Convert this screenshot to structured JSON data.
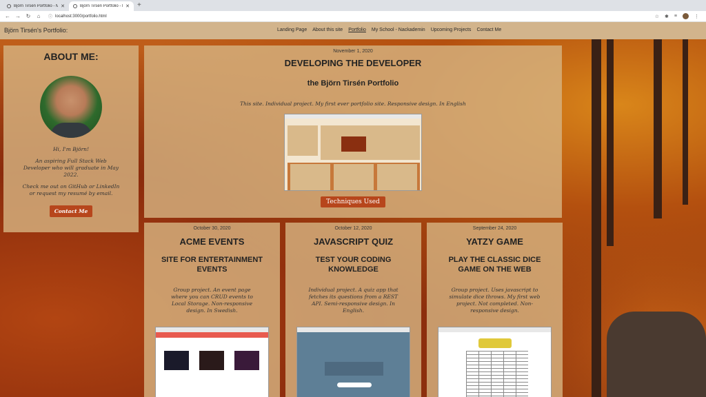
{
  "browser": {
    "tabs": [
      {
        "title": "Björn Tirsén Portfolio - My Sch"
      },
      {
        "title": "Björn Tirsén Portfolio - Develo"
      }
    ],
    "url": "localhost:3000/portfolio.html"
  },
  "site": {
    "brand": "Björn Tirsén's Portfolio:",
    "nav": [
      "Landing Page",
      "About this site",
      "Portfolio",
      "My School - Nackademin",
      "Upcoming Projects",
      "Contact Me"
    ]
  },
  "about": {
    "title": "ABOUT ME:",
    "greeting": "Hi, I'm Björn!",
    "bio": "An aspiring Full Stack Web Developer who will graduate in May 2022.",
    "cta_text": "Check me out on GitHub or LinkedIn or request my resumé by email.",
    "button": "Contact Me"
  },
  "feature": {
    "date": "November 1, 2020",
    "title": "DEVELOPING THE DEVELOPER",
    "subtitle": "the Björn Tirsén Portfolio",
    "desc": "This site. Individual project. My first ever portfolio site. Responsive design. In English",
    "button": "Techniques Used"
  },
  "cards": [
    {
      "date": "October 30, 2020",
      "title": "ACME EVENTS",
      "subtitle": "SITE FOR ENTERTAINMENT EVENTS",
      "desc": "Group project. An event page where you can CRUD events to Local Storage. Non-responsive design. In Swedish."
    },
    {
      "date": "October 12, 2020",
      "title": "JAVASCRIPT QUIZ",
      "subtitle": "TEST YOUR CODING KNOWLEDGE",
      "desc": "Individual project. A quiz app that fetches its questions from a REST API. Semi-responsive design. In English."
    },
    {
      "date": "September 24, 2020",
      "title": "YATZY GAME",
      "subtitle": "PLAY THE CLASSIC DICE GAME ON THE WEB",
      "desc": "Group project. Uses javascript to simulate dice throws. My first web project. Not completed. Non-responsive design."
    }
  ],
  "colors": {
    "accent_button": "#b7461c",
    "nav_bg": "#d2b48c",
    "panel_bg": "#d6b280"
  }
}
